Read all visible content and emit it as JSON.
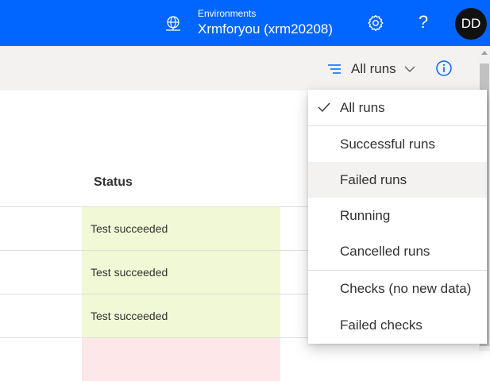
{
  "header": {
    "environment_label": "Environments",
    "environment_name": "Xrmforyou (xrm20208)",
    "help_glyph": "?",
    "avatar_initials": "DD",
    "icons": [
      "globe-icon",
      "gear-icon",
      "help-icon"
    ],
    "bar_color": "#0066ff"
  },
  "commandbar": {
    "filter_label": "All runs",
    "icons": [
      "filter-lines-icon",
      "chevron-down-icon",
      "info-icon"
    ]
  },
  "table": {
    "status_header": "Status",
    "rows": [
      {
        "status": "Test succeeded",
        "color": "#f0f8d6"
      },
      {
        "status": "Test succeeded",
        "color": "#f0f8d6"
      },
      {
        "status": "Test succeeded",
        "color": "#f0f8d6"
      },
      {
        "status": "",
        "color": "#fde7e9"
      }
    ]
  },
  "dropdown": {
    "items": [
      {
        "label": "All runs",
        "selected": true
      },
      {
        "label": "Successful runs",
        "selected": false
      },
      {
        "label": "Failed runs",
        "selected": false,
        "hovered": true
      },
      {
        "label": "Running",
        "selected": false
      },
      {
        "label": "Cancelled runs",
        "selected": false
      },
      {
        "label": "Checks (no new data)",
        "selected": false
      },
      {
        "label": "Failed checks",
        "selected": false
      }
    ]
  }
}
